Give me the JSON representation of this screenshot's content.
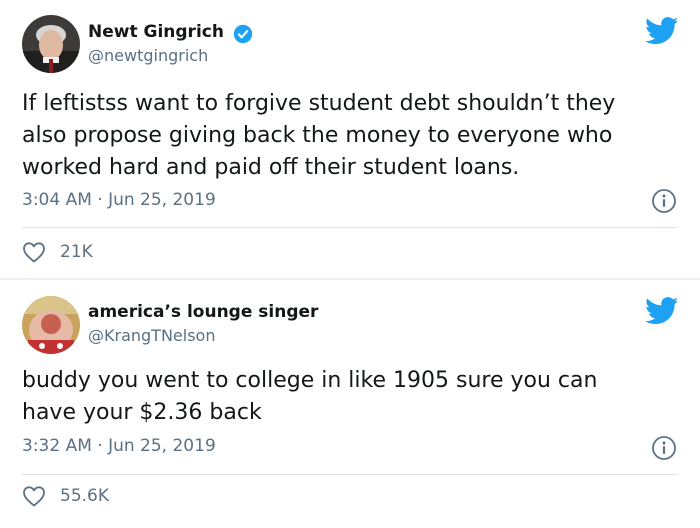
{
  "tweets": [
    {
      "author_name": "Newt Gingrich",
      "handle": "@newtgingrich",
      "verified": true,
      "text": "If leftistss want to forgive student debt shouldn’t they\nalso propose giving back the money to everyone who\nworked hard and paid off their student loans.",
      "timestamp": "3:04 AM · Jun 25, 2019",
      "like_count": "21K"
    },
    {
      "author_name": "america’s lounge singer",
      "handle": "@KrangTNelson",
      "verified": false,
      "text": "buddy you went to college in like 1905 sure you can\nhave your $2.36 back",
      "timestamp": "3:32 AM · Jun 25, 2019",
      "like_count": "55.6K"
    }
  ],
  "icons": {
    "verified": "verified-badge-icon",
    "brand": "twitter-bird-icon",
    "info": "info-icon",
    "like": "heart-icon"
  },
  "colors": {
    "brand_blue": "#1da1f2",
    "secondary_text": "#5b7083",
    "primary_text": "#14171a"
  }
}
